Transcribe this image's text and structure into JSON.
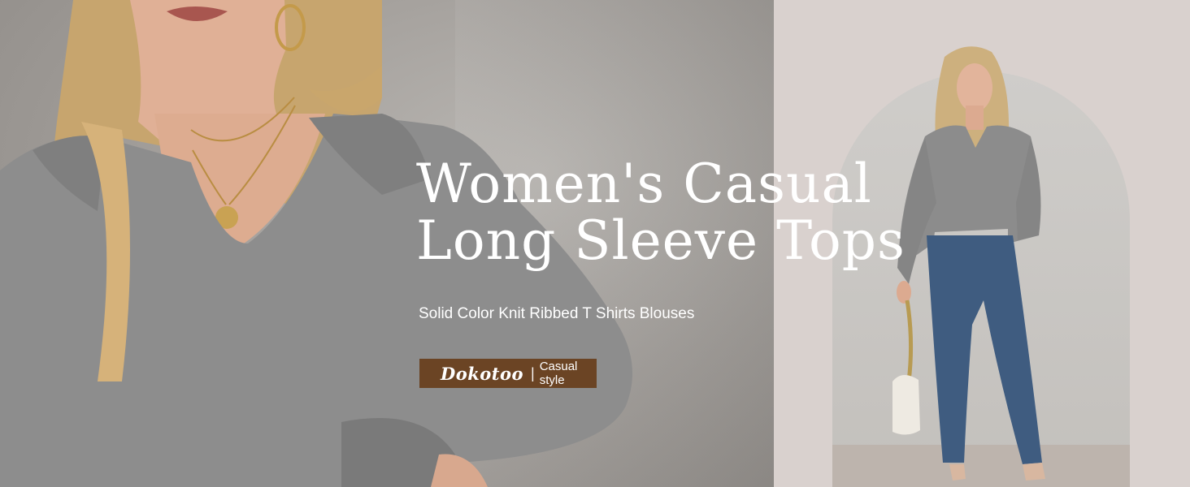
{
  "banner": {
    "headline_line1": "Women's Casual",
    "headline_line2": "Long Sleeve Tops",
    "subtitle": "Solid Color Knit Ribbed T Shirts Blouses",
    "brand_badge": {
      "logo_text": "Dokotoo",
      "separator": "|",
      "tagline": "Casual style"
    }
  },
  "colors": {
    "badge_background": "#6b4424",
    "text": "#ffffff",
    "right_panel_background": "#d9d1ce",
    "top_gray": "#8f8f8f",
    "jeans_blue": "#3f5c80"
  }
}
